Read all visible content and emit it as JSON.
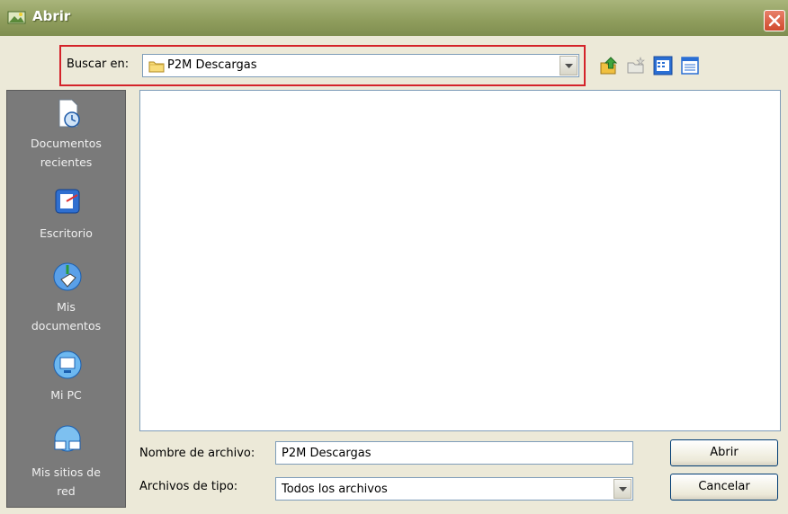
{
  "window": {
    "title": "Abrir",
    "close_icon": "close-icon"
  },
  "lookin": {
    "label": "Buscar en:",
    "value": "P2M Descargas"
  },
  "toolbar": {
    "icons": [
      "up-folder-icon",
      "new-folder-icon",
      "list-view-icon",
      "details-view-icon"
    ]
  },
  "places": [
    {
      "label_lines": [
        "Documentos",
        "recientes"
      ],
      "icon": "recent-documents-icon"
    },
    {
      "label_lines": [
        "Escritorio"
      ],
      "icon": "desktop-icon"
    },
    {
      "label_lines": [
        "Mis",
        "documentos"
      ],
      "icon": "my-documents-icon"
    },
    {
      "label_lines": [
        "Mi PC"
      ],
      "icon": "my-computer-icon"
    },
    {
      "label_lines": [
        "Mis sitios de",
        "red"
      ],
      "icon": "network-places-icon"
    }
  ],
  "filename": {
    "label": "Nombre de archivo:",
    "value": "P2M Descargas"
  },
  "filetype": {
    "label": "Archivos de tipo:",
    "value": "Todos los archivos"
  },
  "buttons": {
    "open": "Abrir",
    "cancel": "Cancelar"
  },
  "colors": {
    "title_bar": "#8e9c5c",
    "highlight_frame": "#d4232a",
    "places_bar": "#7a7a7a"
  }
}
